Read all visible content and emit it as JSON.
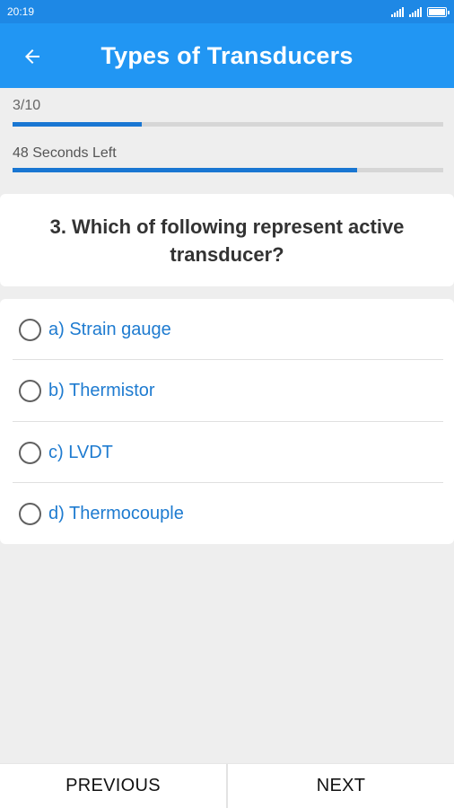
{
  "status_bar": {
    "time": "20:19"
  },
  "app_bar": {
    "title": "Types of Transducers"
  },
  "progress": {
    "question_label": "3/10",
    "question_fraction": 0.3,
    "timer_label": "48 Seconds Left",
    "timer_fraction": 0.8,
    "bar_color": "#1976d2"
  },
  "question": {
    "text": "3. Which of following represent active transducer?"
  },
  "options": [
    {
      "label": "a) Strain gauge"
    },
    {
      "label": "b) Thermistor"
    },
    {
      "label": "c) LVDT"
    },
    {
      "label": "d) Thermocouple"
    }
  ],
  "nav": {
    "previous": "PREVIOUS",
    "next": "NEXT"
  },
  "colors": {
    "primary": "#2196f3",
    "status_bar": "#1e88e5",
    "option_text": "#1e7bd0"
  }
}
